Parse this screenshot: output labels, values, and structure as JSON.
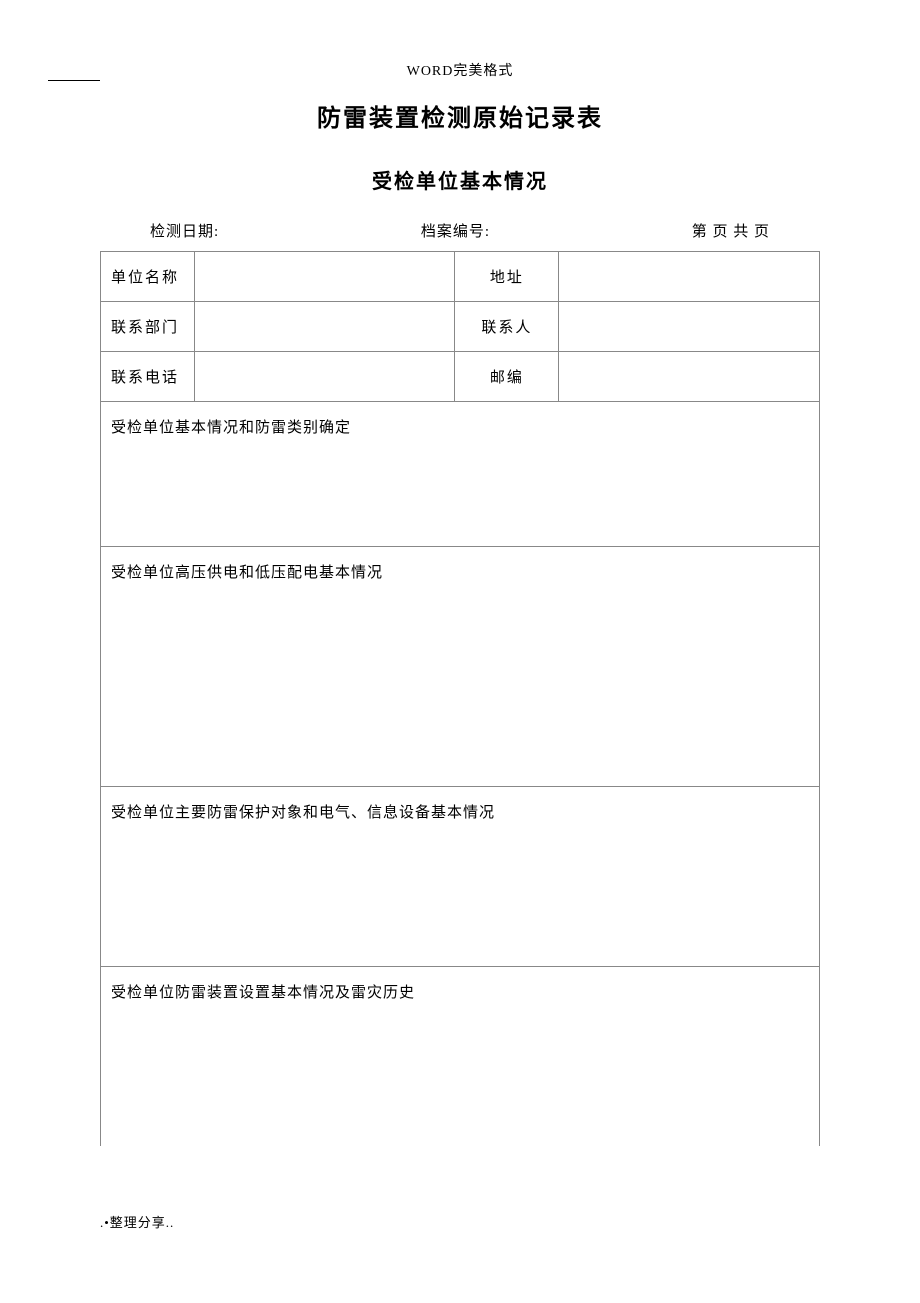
{
  "header": {
    "format_text": "WORD完美格式",
    "title": "防雷装置检测原始记录表",
    "subtitle": "受检单位基本情况"
  },
  "meta": {
    "inspection_date_label": "检测日期:",
    "inspection_date_value": "",
    "file_number_label": "档案编号:",
    "file_number_value": "",
    "page_info": "第 页 共 页"
  },
  "form": {
    "unit_name_label": "单位名称",
    "unit_name_value": "",
    "address_label": "地址",
    "address_value": "",
    "contact_dept_label": "联系部门",
    "contact_dept_value": "",
    "contact_person_label": "联系人",
    "contact_person_value": "",
    "contact_phone_label": "联系电话",
    "contact_phone_value": "",
    "postcode_label": "邮编",
    "postcode_value": ""
  },
  "sections": {
    "s1_title": "受检单位基本情况和防雷类别确定",
    "s1_body": "",
    "s2_title": "受检单位高压供电和低压配电基本情况",
    "s2_body": "",
    "s3_title": "受检单位主要防雷保护对象和电气、信息设备基本情况",
    "s3_body": "",
    "s4_title": "受检单位防雷装置设置基本情况及雷灾历史",
    "s4_body": ""
  },
  "footer": {
    "text": ".•整理分享.."
  }
}
